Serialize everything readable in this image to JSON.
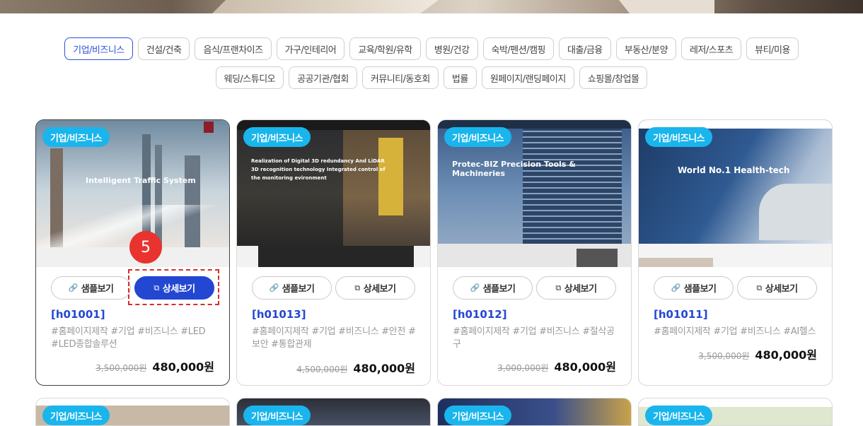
{
  "categories_row1": [
    "기업/비즈니스",
    "건설/건축",
    "음식/프랜차이즈",
    "가구/인테리어",
    "교육/학원/유학",
    "병원/건강",
    "숙박/펜션/캠핑",
    "대출/금융",
    "부동산/분양",
    "레저/스포츠",
    "뷰티/미용"
  ],
  "categories_row2": [
    "웨딩/스튜디오",
    "공공기관/협회",
    "커뮤니티/동호회",
    "법률",
    "원페이지/랜딩페이지",
    "쇼핑몰/창업몰"
  ],
  "active_category": "기업/비즈니스",
  "buttons": {
    "sample": "샘플보기",
    "detail": "상세보기"
  },
  "cards": [
    {
      "tag": "기업/비즈니스",
      "code": "[h01001]",
      "tags": "#홈페이지제작 #기업 #비즈니스 #LED #LED종합솔루션",
      "old_price": "3,500,000원",
      "price": "480,000원",
      "headline": "Intelligent Traffic System"
    },
    {
      "tag": "기업/비즈니스",
      "code": "[h01013]",
      "tags": "#홈페이지제작 #기업 #비즈니스 #안전 #보안 #통합관제",
      "old_price": "4,500,000원",
      "price": "480,000원",
      "headline": "Realization of Digital 3D redundancy And LiDAR 3D recognition technology Integrated control of the monitoring evironment"
    },
    {
      "tag": "기업/비즈니스",
      "code": "[h01012]",
      "tags": "#홈페이지제작 #기업 #비즈니스 #절삭공구",
      "old_price": "3,000,000원",
      "price": "480,000원",
      "headline": "Protec-BIZ Precision Tools & Machineries"
    },
    {
      "tag": "기업/비즈니스",
      "code": "[h01011]",
      "tags": "#홈페이지제작 #기업 #비즈니스 #AI헬스",
      "old_price": "3,500,000원",
      "price": "480,000원",
      "headline": "World No.1 Health-tech"
    }
  ],
  "next_row_tags": [
    "기업/비즈니스",
    "기업/비즈니스",
    "기업/비즈니스",
    "기업/비즈니스"
  ],
  "marker": "5",
  "colors": {
    "accent": "#2347d3",
    "tag_bg": "#19b5ec",
    "marker": "#e8332f"
  }
}
